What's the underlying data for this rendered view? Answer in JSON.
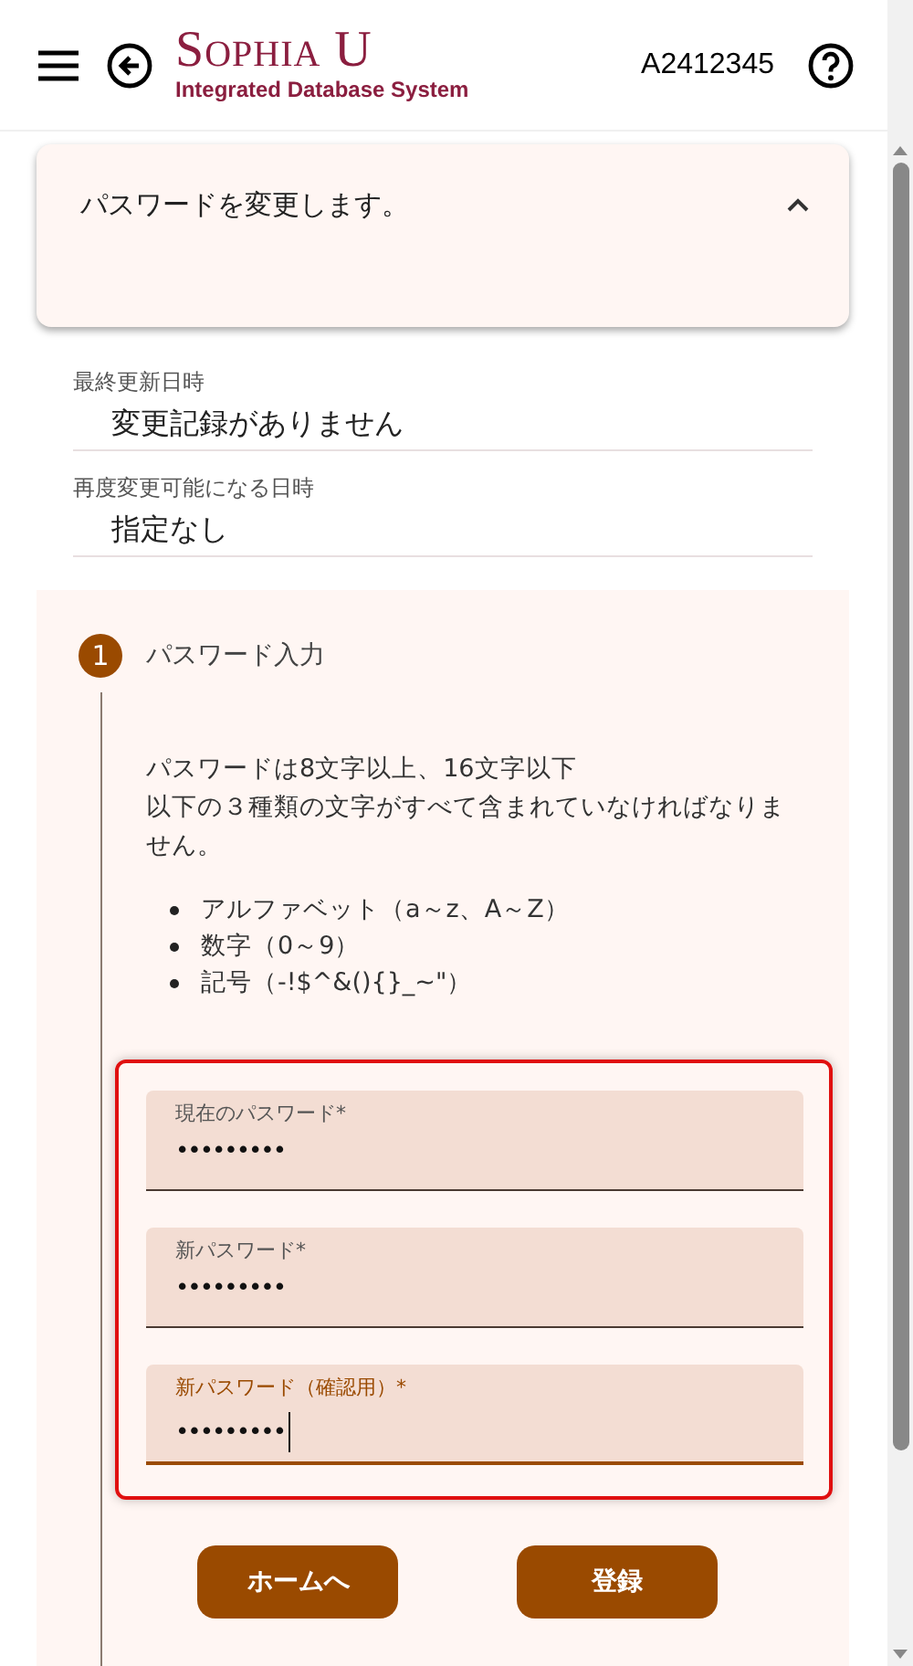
{
  "header": {
    "logo_title": "Sophia U",
    "logo_subtitle": "Integrated Database System",
    "user_id": "A2412345"
  },
  "notice": {
    "text": "パスワードを変更します。",
    "expanded": true
  },
  "info": [
    {
      "label": "最終更新日時",
      "value": "変更記録がありません"
    },
    {
      "label": "再度変更可能になる日時",
      "value": "指定なし"
    }
  ],
  "step": {
    "number": "1",
    "title": "パスワード入力",
    "description": [
      "パスワードは8文字以上、16文字以下",
      "以下の３種類の文字がすべて含まれていなければなりません。"
    ],
    "rules": [
      "アルファベット（a～z、A～Z）",
      "数字（0～9）",
      "記号（-!$^&(){}_~\"）"
    ],
    "fields": [
      {
        "label": "現在のパスワード*",
        "value": "•••••••••",
        "focused": false
      },
      {
        "label": "新パスワード*",
        "value": "•••••••••",
        "focused": false
      },
      {
        "label": "新パスワード（確認用）*",
        "value": "•••••••••",
        "focused": true
      }
    ],
    "buttons": [
      "ホームへ",
      "登録"
    ]
  }
}
